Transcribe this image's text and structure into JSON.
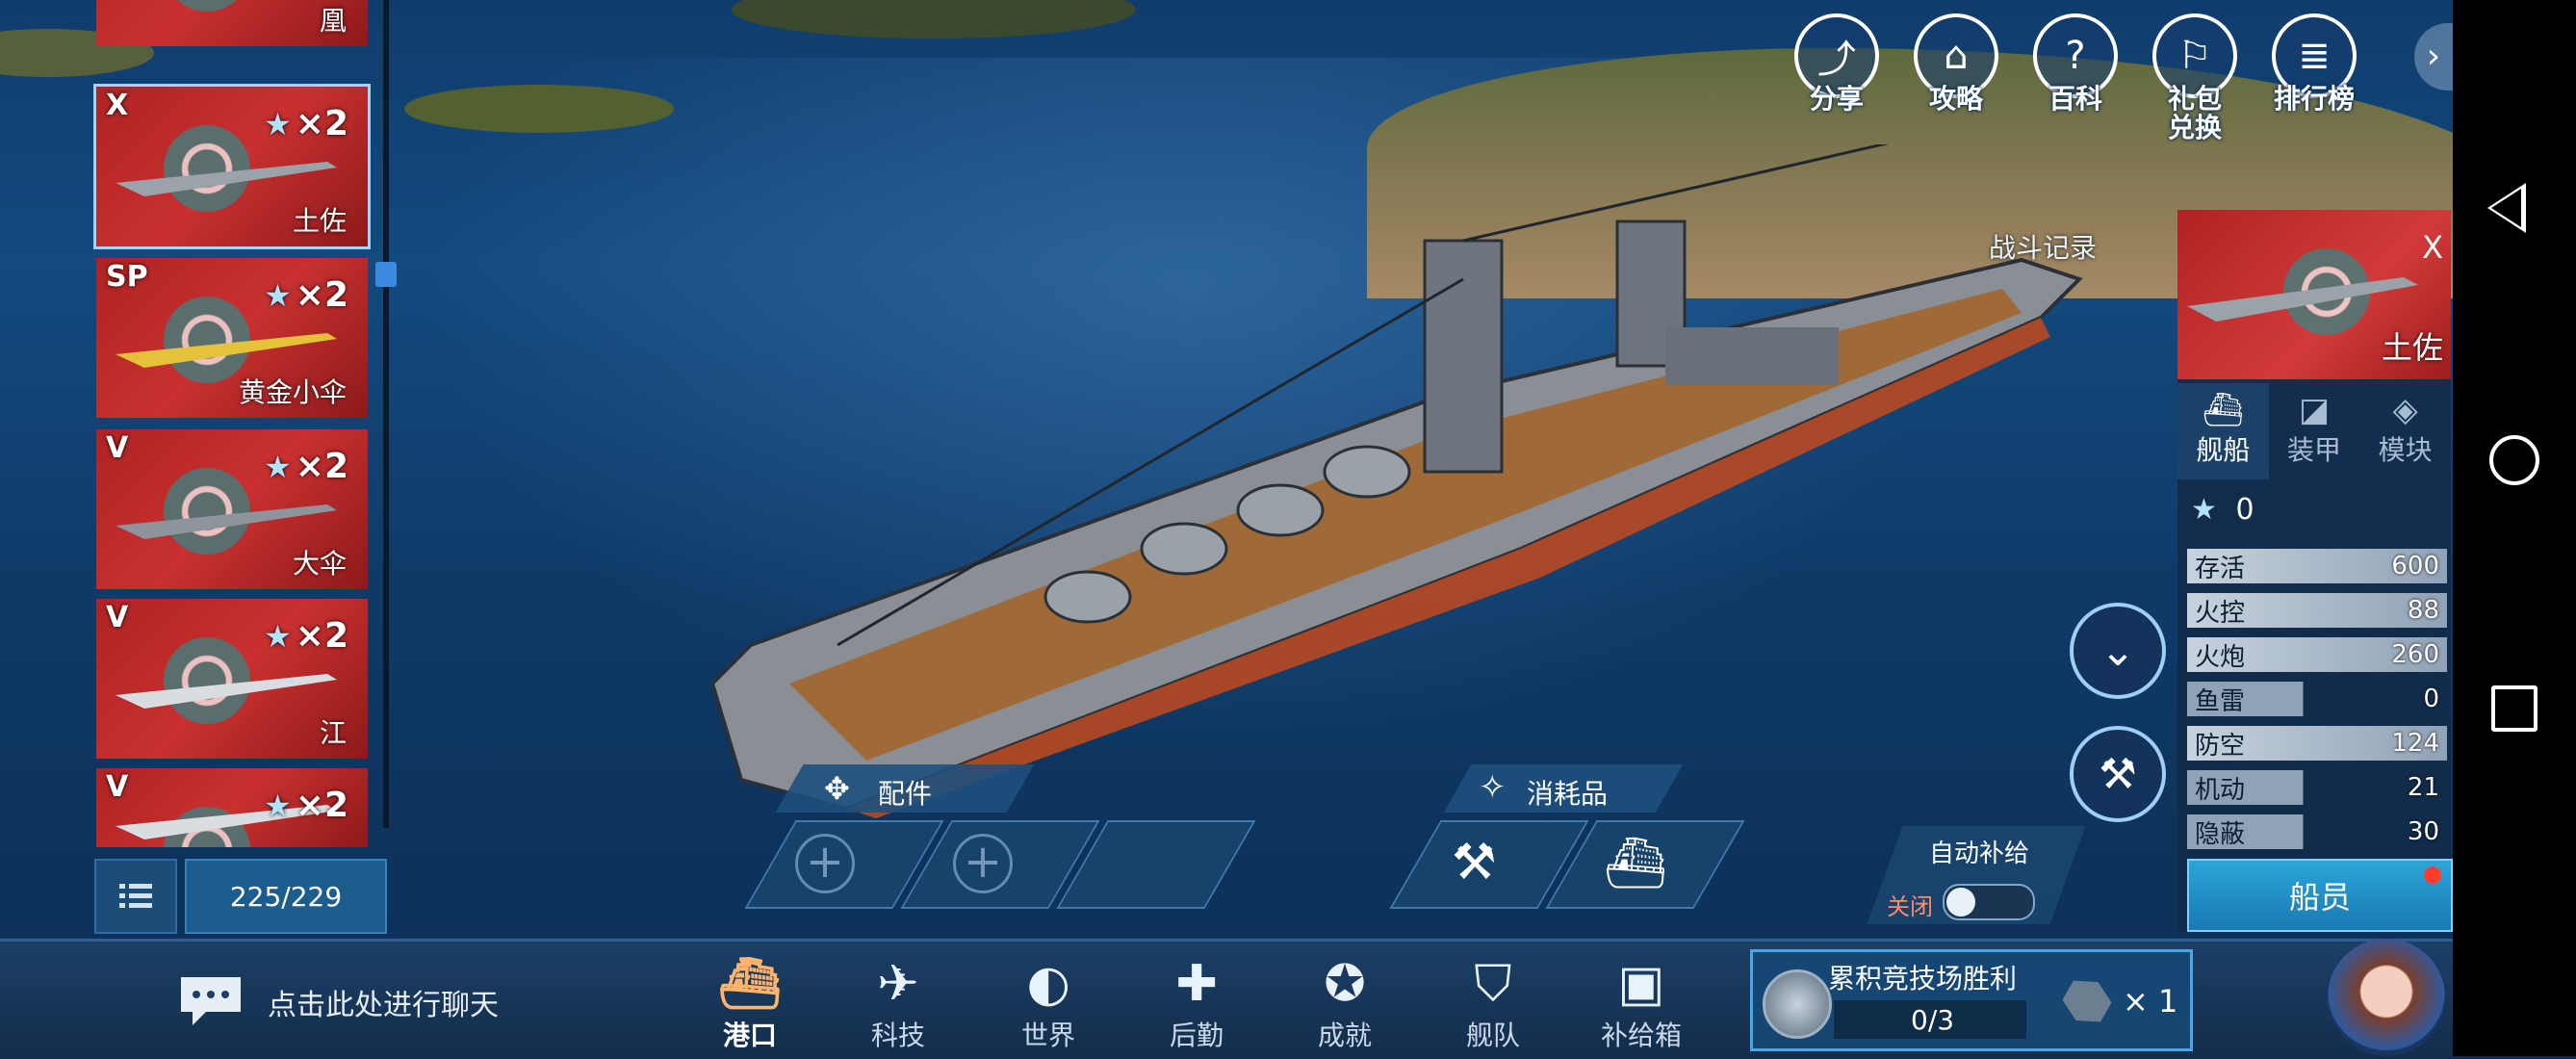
{
  "top_icons": [
    {
      "label": "分享",
      "icon": "share-icon",
      "glyph": "⤴"
    },
    {
      "label": "攻略",
      "icon": "home-guide-icon",
      "glyph": "⌂"
    },
    {
      "label": "百科",
      "icon": "help-book-icon",
      "glyph": "?"
    },
    {
      "label": "礼包兑换",
      "line1": "礼包",
      "line2": "兑换",
      "icon": "gift-icon",
      "glyph": "⚐"
    },
    {
      "label": "排行榜",
      "icon": "ranking-icon",
      "glyph": "≣"
    }
  ],
  "ship_list": [
    {
      "tier": "",
      "name": "凰",
      "count": ""
    },
    {
      "tier": "X",
      "name": "土佐",
      "count": "×2",
      "selected": true
    },
    {
      "tier": "SP",
      "name": "黄金小伞",
      "count": "×2"
    },
    {
      "tier": "V",
      "name": "大伞",
      "count": "×2"
    },
    {
      "tier": "V",
      "name": "江",
      "count": "×2"
    },
    {
      "tier": "V",
      "name": "",
      "count": "×2"
    }
  ],
  "ship_count": "225/229",
  "battle_record": "战斗记录",
  "selected_ship": {
    "tier": "X",
    "name": "土佐",
    "stars": "0"
  },
  "tabs": [
    "舰船",
    "装甲",
    "模块"
  ],
  "stats": [
    {
      "label": "存活",
      "value": "600"
    },
    {
      "label": "火控",
      "value": "88"
    },
    {
      "label": "火炮",
      "value": "260"
    },
    {
      "label": "鱼雷",
      "value": "0"
    },
    {
      "label": "防空",
      "value": "124"
    },
    {
      "label": "机动",
      "value": "21"
    },
    {
      "label": "隐蔽",
      "value": "30"
    }
  ],
  "crew_button": "船员",
  "parts_label": "配件",
  "consumables_label": "消耗品",
  "auto_supply": {
    "label": "自动补给",
    "state": "关闭"
  },
  "chat_placeholder": "点击此处进行聊天",
  "bottom_nav": [
    {
      "label": "港口",
      "icon": "port-icon",
      "glyph": "⛴",
      "active": true
    },
    {
      "label": "科技",
      "icon": "tech-icon",
      "glyph": "✈"
    },
    {
      "label": "世界",
      "icon": "world-icon",
      "glyph": "◐"
    },
    {
      "label": "后勤",
      "icon": "logistics-icon",
      "glyph": "✚"
    },
    {
      "label": "成就",
      "icon": "achievement-icon",
      "glyph": "✪"
    },
    {
      "label": "舰队",
      "icon": "fleet-icon",
      "glyph": "⛉"
    },
    {
      "label": "补给箱",
      "icon": "supply-box-icon",
      "glyph": "▣"
    }
  ],
  "quest": {
    "title": "累积竞技场胜利",
    "progress": "0/3",
    "reward_count": "× 1"
  },
  "colors": {
    "accent": "#2ba5d8",
    "flag_red": "#c83030",
    "panel": "#122a48"
  }
}
